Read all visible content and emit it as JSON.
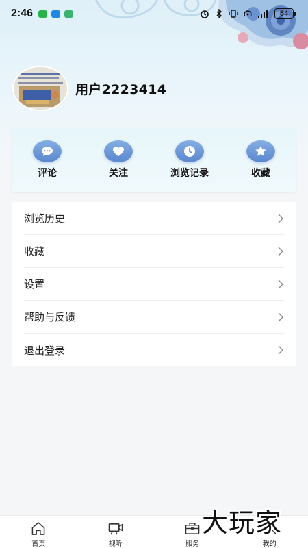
{
  "status_bar": {
    "time": "2:46",
    "battery": "54",
    "app_icon_colors": [
      "#27b34a",
      "#1e88e5",
      "#3cb371"
    ]
  },
  "profile": {
    "username": "用户2223414"
  },
  "quick_actions": [
    {
      "label": "评论",
      "icon": "comment-icon"
    },
    {
      "label": "关注",
      "icon": "heart-icon"
    },
    {
      "label": "浏览记录",
      "icon": "clock-icon"
    },
    {
      "label": "收藏",
      "icon": "star-icon"
    }
  ],
  "menu": [
    {
      "label": "浏览历史"
    },
    {
      "label": "收藏"
    },
    {
      "label": "设置"
    },
    {
      "label": "帮助与反馈"
    },
    {
      "label": "退出登录"
    }
  ],
  "tabbar": [
    {
      "label": "首页",
      "icon": "home-icon"
    },
    {
      "label": "视听",
      "icon": "video-icon"
    },
    {
      "label": "服务",
      "icon": "briefcase-icon"
    },
    {
      "label": "我的",
      "icon": "user-icon"
    }
  ],
  "watermark": "大玩家",
  "colors": {
    "accent_blue": "#5a87cf",
    "hero_bg": "#dff0f8",
    "page_bg": "#f5f6f8"
  }
}
